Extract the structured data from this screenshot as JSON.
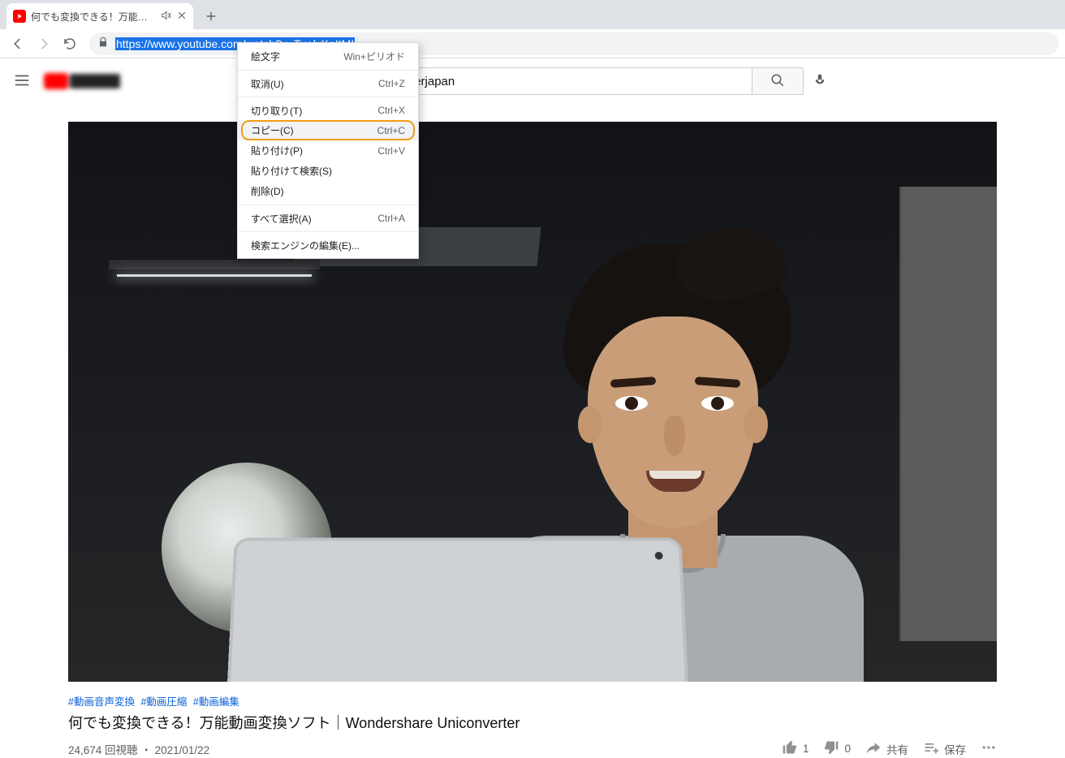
{
  "browser": {
    "tab_title": "何でも変換できる！万能動画変",
    "url_selected": "https://www.youtube.com/watch?v=TuolvKoItMI",
    "url_rest": ""
  },
  "context_menu": {
    "emoji": {
      "label": "絵文字",
      "shortcut": "Win+ピリオド"
    },
    "undo": {
      "label": "取消(U)",
      "shortcut": "Ctrl+Z"
    },
    "cut": {
      "label": "切り取り(T)",
      "shortcut": "Ctrl+X"
    },
    "copy": {
      "label": "コピー(C)",
      "shortcut": "Ctrl+C"
    },
    "paste": {
      "label": "貼り付け(P)",
      "shortcut": "Ctrl+V"
    },
    "paste_search": {
      "label": "貼り付けて検索(S)",
      "shortcut": ""
    },
    "delete": {
      "label": "削除(D)",
      "shortcut": ""
    },
    "select_all": {
      "label": "すべて選択(A)",
      "shortcut": "Ctrl+A"
    },
    "edit_engines": {
      "label": "検索エンジンの編集(E)...",
      "shortcut": ""
    }
  },
  "youtube": {
    "search_value": "uniconverterjapan",
    "hashtags": [
      "#動画音声変換",
      "#動画圧縮",
      "#動画編集"
    ],
    "video_title": "何でも変換できる！万能動画変換ソフト｜Wondershare Uniconverter",
    "views": "24,674 回視聴",
    "sep": "・",
    "date": "2021/01/22",
    "like_count": "1",
    "dislike_count": "0",
    "share_label": "共有",
    "save_label": "保存"
  }
}
